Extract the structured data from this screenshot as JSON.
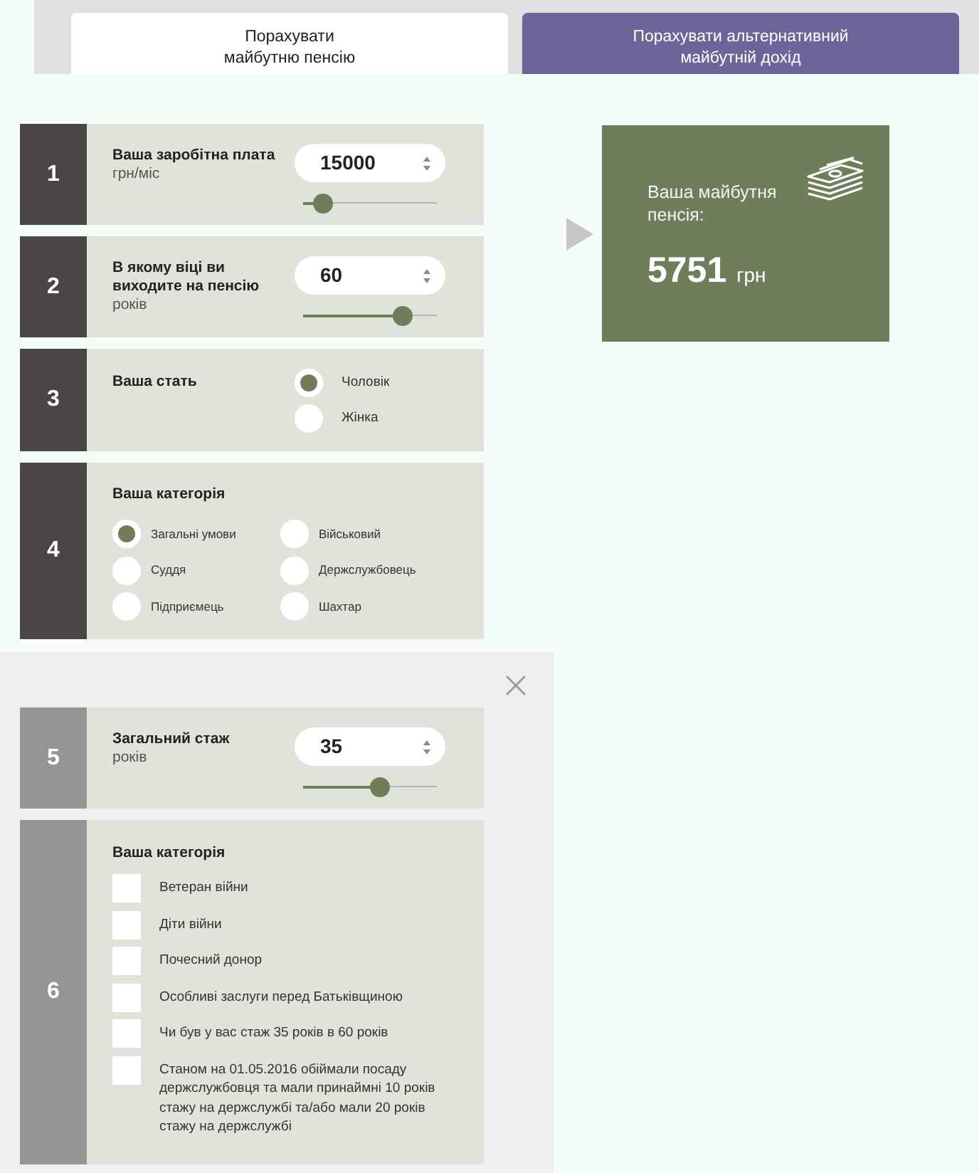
{
  "tabs": [
    {
      "label": "Порахувати\nмайбутню пенсію",
      "selected": true
    },
    {
      "label": "Порахувати альтернативний\nмайбутній дохід",
      "selected": false
    }
  ],
  "steps": [
    {
      "number": "1",
      "kind": "number",
      "title": "Ваша заробітна плата",
      "unit": "грн/міс",
      "value": "15000",
      "level": 0.15
    },
    {
      "number": "2",
      "kind": "number",
      "title": "В якому віці ви виходите на пенсію",
      "unit": "років",
      "value": "60",
      "level": 0.74
    },
    {
      "number": "3",
      "kind": "radio",
      "title": "Ваша стать",
      "options": [
        {
          "label": "Чоловік",
          "selected": true
        },
        {
          "label": "Жінка",
          "selected": false
        }
      ]
    },
    {
      "number": "4",
      "kind": "radio_grid",
      "title": "Ваша категорія",
      "options": [
        {
          "label": "Загальні умови",
          "selected": true
        },
        {
          "label": "Військовий",
          "selected": false
        },
        {
          "label": "Суддя",
          "selected": false
        },
        {
          "label": "Держслужбовець",
          "selected": false
        },
        {
          "label": "Підприємець",
          "selected": false
        },
        {
          "label": "Шахтар",
          "selected": false
        }
      ]
    }
  ],
  "result": {
    "title": "Ваша майбутня пенсія:",
    "amount": "5751",
    "currency": "грн"
  },
  "extra_steps": [
    {
      "number": "5",
      "kind": "number",
      "title": "Загальний стаж",
      "unit": "років",
      "value": "35",
      "level": 0.57
    },
    {
      "number": "6",
      "kind": "checkbox",
      "title": "Ваша категорія",
      "options": [
        {
          "label": "Ветеран війни",
          "checked": false
        },
        {
          "label": "Діти війни",
          "checked": false
        },
        {
          "label": "Почесний донор",
          "checked": false
        },
        {
          "label": "Особливі заслуги перед Батьківщиною",
          "checked": false
        },
        {
          "label": "Чи був у вас стаж 35 років в 60 років",
          "checked": false
        },
        {
          "label": "Станом на 01.05.2016 обіймали посаду держслужбовця та мали принаймні 10 років стажу на держслужбі та/або мали 20 років стажу на держслужбі",
          "checked": false
        }
      ]
    }
  ]
}
